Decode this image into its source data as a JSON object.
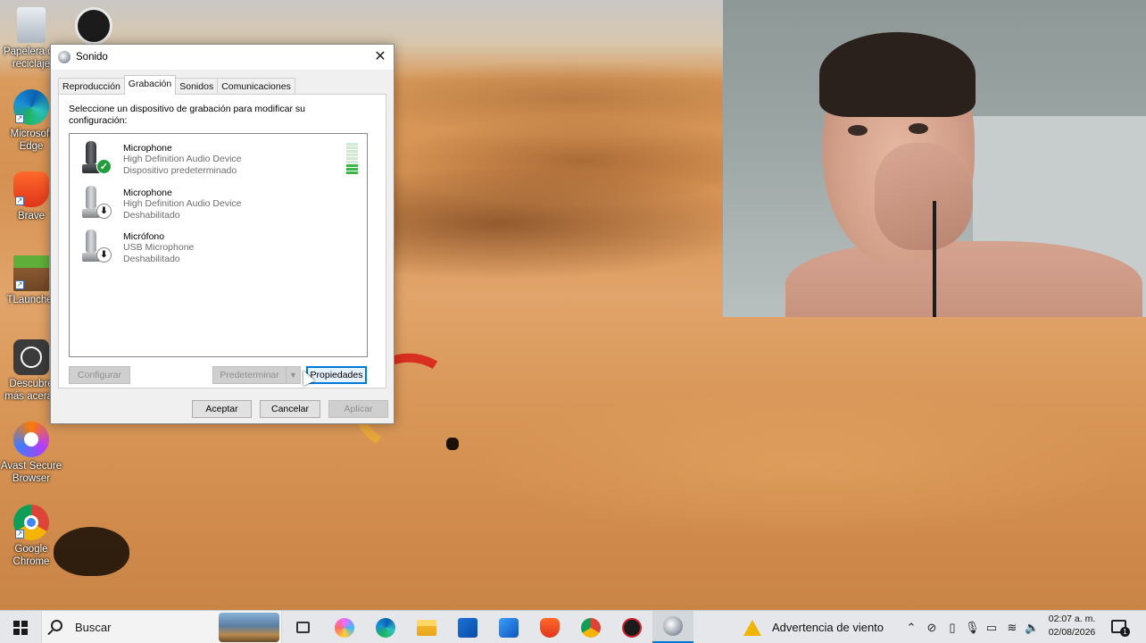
{
  "desktop": {
    "icons": [
      {
        "label": "Papelera de reciclaje",
        "icon": "recycle-bin-icon"
      },
      {
        "label": "Microsoft Edge",
        "icon": "edge-icon"
      },
      {
        "label": "Brave",
        "icon": "brave-icon"
      },
      {
        "label": "TLauncher",
        "icon": "minecraft-icon"
      },
      {
        "label": "Descubre más aceras",
        "icon": "discover-icon"
      },
      {
        "label": "Avast Secure Browser",
        "icon": "avast-icon"
      },
      {
        "label": "Google Chrome",
        "icon": "chrome-icon"
      }
    ]
  },
  "dialog": {
    "title": "Sonido",
    "tabs": [
      {
        "label": "Reproducción",
        "active": false
      },
      {
        "label": "Grabación",
        "active": true
      },
      {
        "label": "Sonidos",
        "active": false
      },
      {
        "label": "Comunicaciones",
        "active": false
      }
    ],
    "instruction": "Seleccione un dispositivo de grabación para modificar su configuración:",
    "devices": [
      {
        "name": "Microphone",
        "driver": "High Definition Audio Device",
        "status": "Dispositivo predeterminado",
        "badge": "check-badge-icon",
        "level": 0.35
      },
      {
        "name": "Microphone",
        "driver": "High Definition Audio Device",
        "status": "Deshabilitado",
        "badge": "down-arrow-badge-icon"
      },
      {
        "name": "Micrófono",
        "driver": "USB Microphone",
        "status": "Deshabilitado",
        "badge": "down-arrow-badge-icon"
      }
    ],
    "buttons": {
      "configure": "Configurar",
      "set_default": "Predeterminar",
      "properties": "Propiedades",
      "ok": "Aceptar",
      "cancel": "Cancelar",
      "apply": "Aplicar"
    }
  },
  "taskbar": {
    "search_placeholder": "Buscar",
    "weather_text": "Advertencia de viento",
    "time": "02:07 a. m.",
    "date": "02/08/2026",
    "notification_count": "1",
    "apps": [
      "task-view-icon",
      "copilot-icon",
      "edge-icon",
      "file-explorer-icon",
      "store-icon",
      "outlook-icon",
      "brave-icon",
      "chrome-icon",
      "obs-icon",
      "sound-settings-icon"
    ]
  },
  "colors": {
    "accent": "#0078d7",
    "default_device_badge": "#1f9d3a",
    "level_meter": "#3cb44b"
  }
}
